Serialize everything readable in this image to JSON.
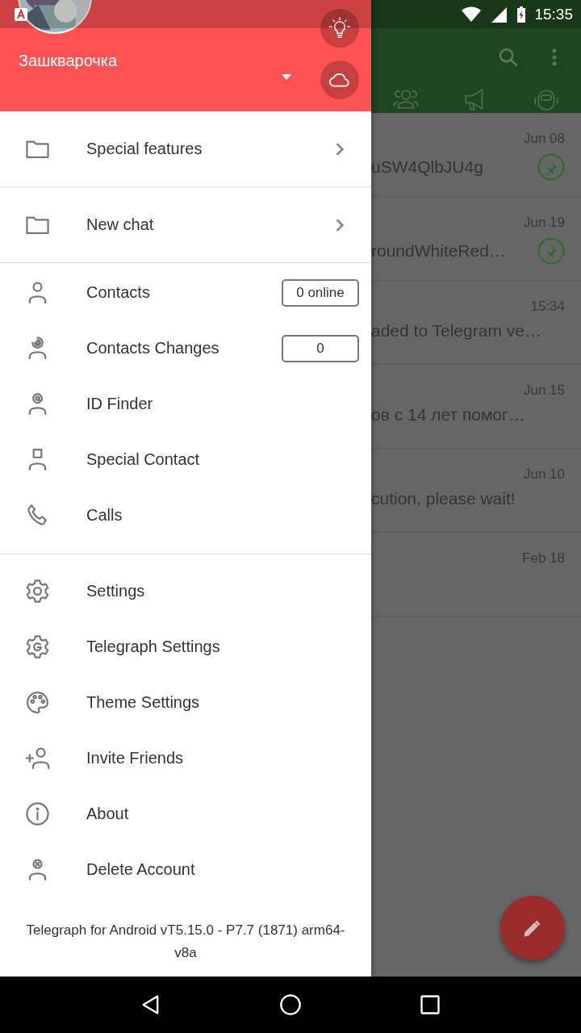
{
  "status_bar": {
    "time": "15:35"
  },
  "drawer": {
    "header": {
      "name": "Зашкварочка"
    },
    "sections": [
      [
        {
          "kind": "folder",
          "label": "Special features"
        }
      ],
      [
        {
          "kind": "folder",
          "label": "New chat"
        }
      ],
      [
        {
          "kind": "item",
          "label": "Contacts",
          "badge": "0 online"
        },
        {
          "kind": "item",
          "label": "Contacts Changes",
          "badge": "0"
        },
        {
          "kind": "item",
          "label": "ID Finder"
        },
        {
          "kind": "item",
          "label": "Special Contact"
        },
        {
          "kind": "item",
          "label": "Calls"
        }
      ],
      [
        {
          "kind": "item",
          "label": "Settings"
        },
        {
          "kind": "item",
          "label": "Telegraph Settings"
        },
        {
          "kind": "item",
          "label": "Theme Settings"
        },
        {
          "kind": "item",
          "label": "Invite Friends"
        },
        {
          "kind": "item",
          "label": "About"
        },
        {
          "kind": "item",
          "label": "Delete Account"
        }
      ]
    ],
    "footer": "Telegraph for Android vT5.15.0 - P7.7 (1871) arm64-v8a"
  },
  "chats": [
    {
      "time": "Jun 08",
      "preview": "uSW4QlbJU4g",
      "pinned": true
    },
    {
      "time": "Jun 19",
      "preview": "roundWhiteRed…",
      "pinned": true
    },
    {
      "time": "15:34",
      "preview": "aded to Telegram ve…",
      "pinned": false
    },
    {
      "time": "Jun 15",
      "preview": "ов с 14 лет помог…",
      "pinned": false
    },
    {
      "time": "Jun 10",
      "preview": "cution, please wait!",
      "pinned": false
    },
    {
      "time": "Feb 18",
      "pinned": false
    }
  ]
}
